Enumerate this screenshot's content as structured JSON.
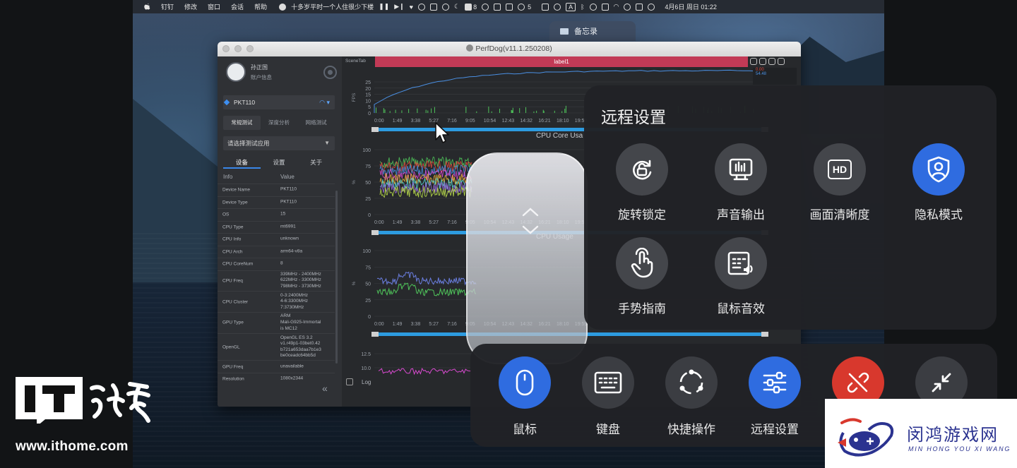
{
  "menubar": {
    "items": [
      "钉钉",
      "修改",
      "窗口",
      "会话",
      "帮助"
    ],
    "now_playing": "十多岁平时一个人住很少下楼",
    "wechat_count": "5",
    "notif_count": "8",
    "input_label": "A",
    "datetime": "4月6日 周日 01:22"
  },
  "folder_tab": {
    "label": "备忘录"
  },
  "perfdog": {
    "title": "PerfDog(v11.1.250208)",
    "user_name": "孙正国",
    "user_info": "账户信息",
    "device": "PKT110",
    "mode_tabs": [
      "常规测试",
      "深度分析",
      "网络测试"
    ],
    "app_select": "请选择测试应用",
    "sub_tabs": [
      "设备",
      "设置",
      "关于"
    ],
    "info_head": [
      "Info",
      "Value"
    ],
    "info_rows": [
      {
        "k": "Device Name",
        "v": [
          "PKT110"
        ]
      },
      {
        "k": "Device Type",
        "v": [
          "PKT110"
        ]
      },
      {
        "k": "OS",
        "v": [
          "15"
        ]
      },
      {
        "k": "CPU Type",
        "v": [
          "mt6991"
        ]
      },
      {
        "k": "CPU Info",
        "v": [
          "unknown"
        ]
      },
      {
        "k": "CPU Arch",
        "v": [
          "arm64-v8a"
        ]
      },
      {
        "k": "CPU CoreNum",
        "v": [
          "8"
        ]
      },
      {
        "k": "CPU Freq",
        "v": [
          "339MHz - 2400MHz",
          "622MHz - 3300MHz",
          "798MHz - 3730MHz"
        ]
      },
      {
        "k": "CPU Cluster",
        "v": [
          "0-3:2400MHz",
          "4-6:3300MHz",
          "7:3730MHz"
        ]
      },
      {
        "k": "GPU Type",
        "v": [
          "ARM",
          "Mali-G925-Immortal",
          "is MC12"
        ]
      },
      {
        "k": "OpenGL",
        "v": [
          "OpenGL ES 3.2",
          "v1.r49p1-03bet0.42",
          "b721a653daa7b1e3",
          "be0ceadc64bb5d"
        ]
      },
      {
        "k": "GPU Freq",
        "v": [
          "unavailable"
        ]
      },
      {
        "k": "Resolution",
        "v": [
          "1080x2344"
        ]
      }
    ],
    "scene_tab": "SceneTab",
    "label_bar": "label1",
    "legend_values": [
      "0.00",
      "54.48"
    ],
    "log_label": "Log",
    "time_ticks": [
      "0:00",
      "1:49",
      "3:38",
      "5:27",
      "7:16",
      "9:05",
      "10:54",
      "12:43",
      "14:32",
      "16:21",
      "18:10",
      "19:59"
    ],
    "charts": [
      {
        "title": "",
        "ylabel": "FPS",
        "yticks": [
          "25",
          "20",
          "15",
          "10",
          "5",
          "0"
        ]
      },
      {
        "title": "CPU Core Usa",
        "ylabel": "%",
        "yticks": [
          "100",
          "75",
          "50",
          "25",
          "0"
        ]
      },
      {
        "title": "CPU Usage",
        "ylabel": "%",
        "yticks": [
          "100",
          "75",
          "50",
          "25",
          "0"
        ]
      },
      {
        "title": "",
        "ylabel": "",
        "yticks": [
          "12.5",
          "10.0"
        ]
      }
    ]
  },
  "remote_settings": {
    "title": "远程设置",
    "items": [
      {
        "label": "旋转锁定",
        "icon": "rotate-lock-icon",
        "active": false
      },
      {
        "label": "声音输出",
        "icon": "sound-output-icon",
        "active": false
      },
      {
        "label": "画面清晰度",
        "icon": "hd-icon",
        "icon_text": "HD",
        "active": false
      },
      {
        "label": "隐私模式",
        "icon": "privacy-shield-icon",
        "active": true
      },
      {
        "label": "手势指南",
        "icon": "gesture-hand-icon",
        "active": false
      },
      {
        "label": "鼠标音效",
        "icon": "mouse-sound-icon",
        "active": false
      }
    ]
  },
  "toolbar": {
    "items": [
      {
        "label": "鼠标",
        "icon": "mouse-icon",
        "state": "active"
      },
      {
        "label": "键盘",
        "icon": "keyboard-icon",
        "state": "normal"
      },
      {
        "label": "快捷操作",
        "icon": "quick-actions-icon",
        "state": "normal"
      },
      {
        "label": "远程设置",
        "icon": "remote-settings-icon",
        "state": "active"
      },
      {
        "label": "",
        "icon": "disconnect-icon",
        "state": "danger"
      },
      {
        "label": "",
        "icon": "minimize-icon",
        "state": "normal"
      }
    ]
  },
  "watermarks": {
    "ithome_logo": "IT之家",
    "ithome_url": "www.ithome.com",
    "minhong_cn": "闵鸿游戏网",
    "minhong_en": "MIN HONG YOU XI WANG"
  },
  "colors": {
    "accent_blue": "#2f6ce0",
    "danger_red": "#d8382d",
    "label_bar": "#c23a56"
  }
}
